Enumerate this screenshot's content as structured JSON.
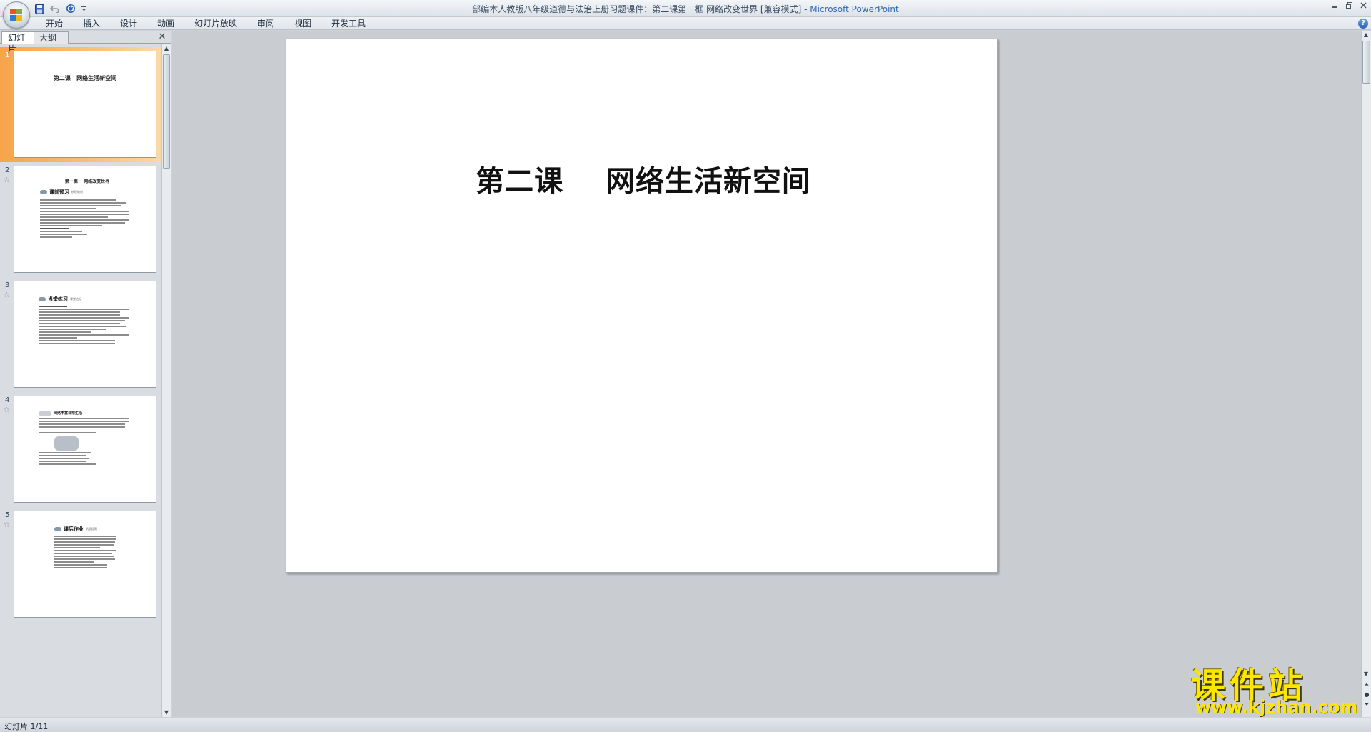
{
  "window": {
    "title_doc": "部编本人教版八年级道德与法治上册习题课件：第二课第一框  网络改变世界 [兼容模式] - ",
    "title_app": "Microsoft PowerPoint"
  },
  "quick_access": [
    "save-icon",
    "undo-icon",
    "redo-icon",
    "customize-icon"
  ],
  "ribbon": {
    "tabs": [
      "开始",
      "插入",
      "设计",
      "动画",
      "幻灯片放映",
      "审阅",
      "视图",
      "开发工具"
    ]
  },
  "pane": {
    "tab_slides": "幻灯片",
    "tab_outline": "大纲",
    "close_glyph": "✕"
  },
  "thumbnails": [
    {
      "num": "1",
      "title": "第二课   网络生活新空间",
      "selected": true
    },
    {
      "num": "2",
      "heading": "第一框    网络改变世界",
      "section": "课前预习",
      "tag": "梳理教材"
    },
    {
      "num": "3",
      "section": "当堂练习",
      "tag": "课堂达标"
    },
    {
      "num": "4",
      "section": "网络丰富日常生活",
      "tag": ""
    },
    {
      "num": "5",
      "section": "课后作业",
      "tag": "巩固提高"
    }
  ],
  "slide": {
    "title": "第二课    网络生活新空间"
  },
  "status": {
    "slide_indicator": "幻灯片 1/11"
  },
  "watermark": {
    "main": "课件站",
    "sub": "www.kjzhan.com"
  },
  "colors": {
    "selected_thumb": "#f7a44a",
    "title_app": "#3166b0",
    "watermark": "#ffe600"
  }
}
